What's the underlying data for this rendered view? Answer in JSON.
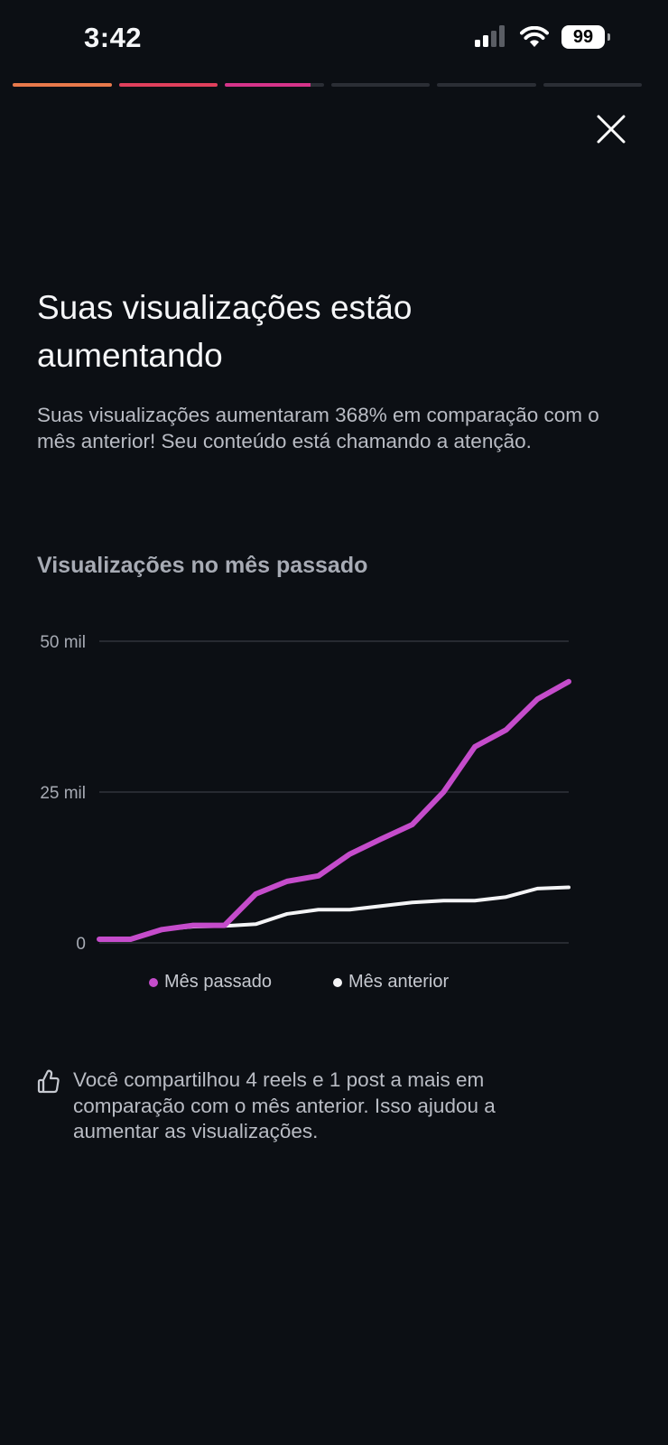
{
  "status_bar": {
    "time": "3:42",
    "battery": "99"
  },
  "story_progress": {
    "segments": [
      {
        "fill": 1,
        "color": "#e8794b"
      },
      {
        "fill": 1,
        "color": "#e0405c"
      },
      {
        "fill": 0.87,
        "color": "#d6348a"
      },
      {
        "fill": 0,
        "color": "#2b2e35"
      },
      {
        "fill": 0,
        "color": "#2b2e35"
      },
      {
        "fill": 0,
        "color": "#2b2e35"
      }
    ]
  },
  "header": {
    "close_icon": "close-icon"
  },
  "content": {
    "title": "Suas visualizações estão aumentando",
    "description": "Suas visualizações aumentaram 368% em comparação com o mês anterior! Seu conteúdo está chamando a atenção.",
    "chart_heading": "Visualizações no mês passado",
    "tip_icon": "thumbs-up-icon",
    "tip_text": "Você compartilhou 4 reels e 1 post a mais em comparação com o mês anterior. Isso ajudou a aumentar as visualizações."
  },
  "chart_data": {
    "type": "line",
    "title": "Visualizações no mês passado",
    "x": [
      1,
      2,
      3,
      4,
      5,
      6,
      7,
      8,
      9,
      10,
      11,
      12,
      13,
      14,
      15,
      16
    ],
    "ylim": [
      0,
      50000
    ],
    "y_ticks": [
      {
        "value": 0,
        "label": "0"
      },
      {
        "value": 25000,
        "label": "25 mil"
      },
      {
        "value": 50000,
        "label": "50 mil"
      }
    ],
    "grid": true,
    "legend_position": "bottom",
    "series": [
      {
        "name": "Mês passado",
        "color": "#c54ccb",
        "values": [
          600,
          600,
          2200,
          2900,
          2900,
          8100,
          10200,
          11100,
          14700,
          17200,
          19600,
          25000,
          32500,
          35300,
          40400,
          43300
        ]
      },
      {
        "name": "Mês anterior",
        "color": "#f4f4f6",
        "values": [
          600,
          600,
          2200,
          2700,
          2800,
          3100,
          4800,
          5500,
          5500,
          6100,
          6700,
          7000,
          7000,
          7600,
          9000,
          9200
        ]
      }
    ]
  }
}
